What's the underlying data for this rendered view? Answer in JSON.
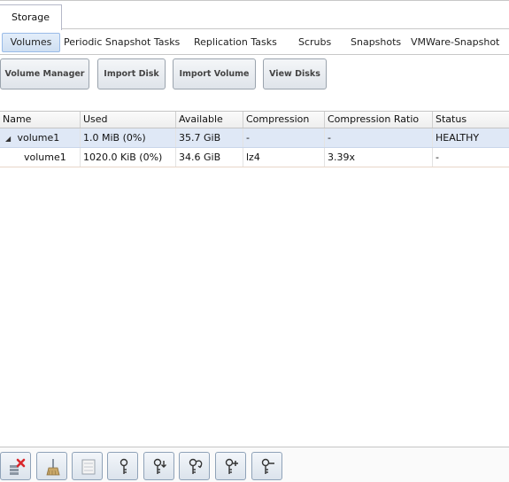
{
  "top_tabs": [
    {
      "label": "Storage"
    }
  ],
  "sub_tabs": [
    {
      "label": "Volumes"
    },
    {
      "label": "Periodic Snapshot Tasks"
    },
    {
      "label": "Replication Tasks"
    },
    {
      "label": "Scrubs"
    },
    {
      "label": "Snapshots"
    },
    {
      "label": "VMWare-Snapshot"
    }
  ],
  "actions": [
    {
      "label": "Volume Manager"
    },
    {
      "label": "Import Disk"
    },
    {
      "label": "Import Volume"
    },
    {
      "label": "View Disks"
    }
  ],
  "table": {
    "columns": [
      "Name",
      "Used",
      "Available",
      "Compression",
      "Compression Ratio",
      "Status"
    ],
    "rows": [
      {
        "name": "volume1",
        "used": "1.0 MiB (0%)",
        "available": "35.7 GiB",
        "compression": "-",
        "ratio": "-",
        "status": "HEALTHY"
      },
      {
        "name": "volume1",
        "used": "1020.0 KiB (0%)",
        "available": "34.6 GiB",
        "compression": "lz4",
        "ratio": "3.39x",
        "status": "-"
      }
    ]
  },
  "bottom_icons": [
    {
      "icon": "detach-volume-icon"
    },
    {
      "icon": "scrub-volume-icon"
    },
    {
      "icon": "volume-status-icon"
    },
    {
      "icon": "lock-key-icon"
    },
    {
      "icon": "download-key-icon"
    },
    {
      "icon": "change-passphrase-icon"
    },
    {
      "icon": "add-recovery-key-icon"
    },
    {
      "icon": "remove-recovery-key-icon"
    }
  ],
  "colors": {
    "selected_row": "#dfe8f6",
    "accent": "#99bbe8",
    "danger": "#d9262b"
  }
}
